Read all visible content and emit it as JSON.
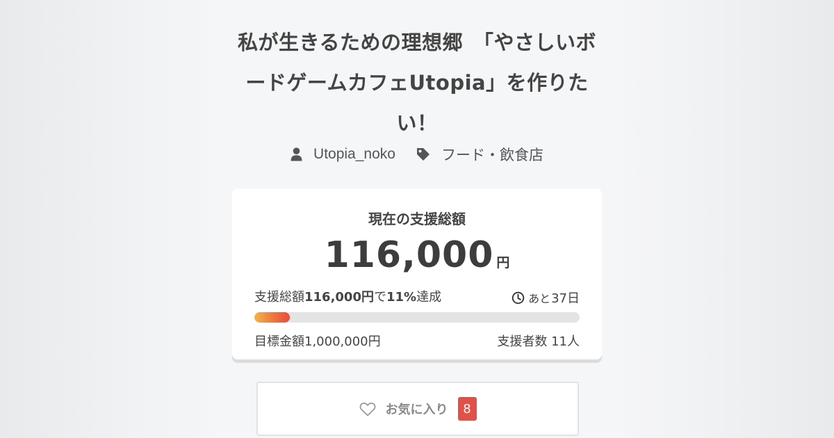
{
  "project": {
    "title": "私が生きるための理想郷　「やさしいボードゲームカフェUtopia」を作りたい！",
    "author": "Utopia_noko",
    "category": "フード・飲食店",
    "author_icon": "user-icon",
    "category_icon": "tag-icon"
  },
  "funding": {
    "label": "現在の支援総額",
    "amount": "116,000",
    "currency": "円",
    "stats_prefix": "支援総額",
    "stats_amount": "116,000円",
    "stats_mid": "で",
    "stats_percent": "11%",
    "stats_suffix": "達成",
    "remaining_prefix": "あと",
    "remaining_value": "37日",
    "remaining_icon": "clock-icon",
    "progress_percent": 11,
    "goal": "目標金額1,000,000円",
    "supporters": "支援者数 11人"
  },
  "favorite": {
    "label": "お気に入り",
    "count": "8",
    "icon": "heart-icon"
  },
  "colors": {
    "badge": "#e15147",
    "progress_start": "#f3b54a",
    "progress_end": "#e94c3b",
    "text": "#444444"
  }
}
